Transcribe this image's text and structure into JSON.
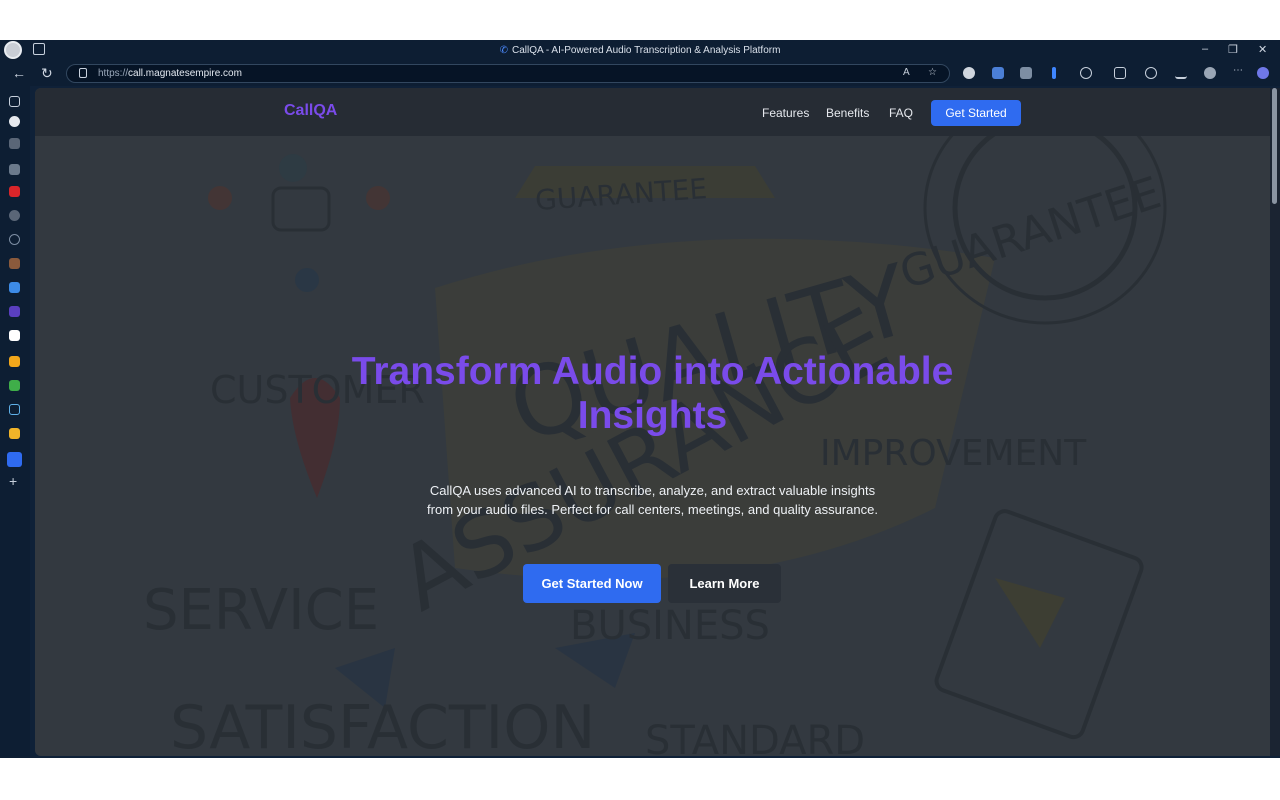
{
  "browser": {
    "window_title": "CallQA - AI-Powered Audio Transcription & Analysis Platform",
    "url_scheme": "https://",
    "url_host": "call.magnatesempire.com",
    "controls": {
      "minimize": "–",
      "restore": "❐",
      "close": "✕"
    },
    "nav": {
      "back": "←",
      "refresh": "↻"
    }
  },
  "site": {
    "brand": "CallQA",
    "nav": {
      "features": "Features",
      "benefits": "Benefits",
      "faq": "FAQ",
      "get_started": "Get Started"
    },
    "hero": {
      "title_line1": "Transform Audio into Actionable",
      "title_line2": "Insights",
      "subtitle": "CallQA uses advanced AI to transcribe, analyze, and extract valuable insights from your audio files. Perfect for call centers, meetings, and quality assurance.",
      "primary_cta": "Get Started Now",
      "secondary_cta": "Learn More"
    },
    "background_words": {
      "customer": "CUSTOMER",
      "guarantee_banner": "GUARANTEE",
      "guarantee_seal": "GUARANTEE",
      "quality": "QUALITY",
      "assurance": "ASSURANCE",
      "improvement": "IMPROVEMENT",
      "service": "SERVICE",
      "business": "BUSINESS",
      "satisfaction": "SATISFACTION",
      "standard": "STANDARD"
    }
  },
  "colors": {
    "brand_purple": "#7a4bea",
    "cta_blue": "#2f6bf0",
    "nav_bg": "#262c34"
  }
}
